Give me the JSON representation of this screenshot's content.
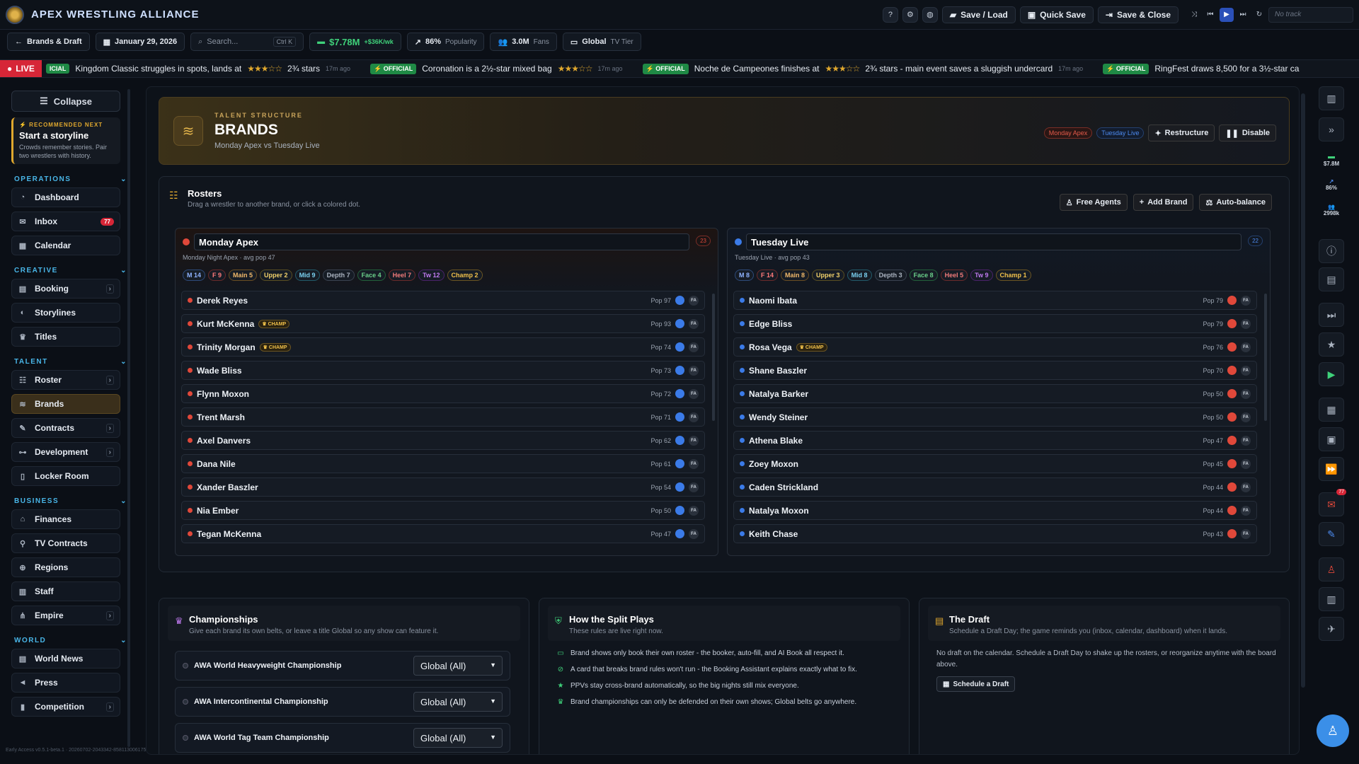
{
  "app": {
    "title": "APEX WRESTLING ALLIANCE"
  },
  "topbar": {
    "save_load": "Save / Load",
    "quick_save": "Quick Save",
    "save_close": "Save & Close",
    "track": "No track"
  },
  "bar2": {
    "back": "Brands & Draft",
    "date": "January 29, 2026",
    "search_placeholder": "Search...",
    "search_kbd": "Ctrl K",
    "money": "$7.78M",
    "money_delta": "+$36K/wk",
    "popularity": "86%",
    "popularity_label": "Popularity",
    "fans": "3.0M",
    "fans_label": "Fans",
    "tier": "Global",
    "tier_label": "TV Tier"
  },
  "ticker": {
    "live": "LIVE",
    "lead_tag": "ICIAL",
    "items": [
      {
        "text": "Kingdom Classic struggles in spots, lands at",
        "stars": "★★★☆☆",
        "rating": "2¾ stars",
        "ago": "17m ago",
        "official": ""
      },
      {
        "official": "⚡ OFFICIAL",
        "text": "Coronation is a 2½-star mixed bag",
        "stars": "★★★☆☆",
        "rating": "",
        "ago": "17m ago"
      },
      {
        "official": "⚡ OFFICIAL",
        "text": "Noche de Campeones finishes at",
        "stars": "★★★☆☆",
        "rating": "2¾ stars - main event saves a sluggish undercard",
        "ago": "17m ago"
      },
      {
        "official": "⚡ OFFICIAL",
        "text": "RingFest draws 8,500 for a 3½-star ca",
        "stars": "",
        "rating": "",
        "ago": ""
      }
    ]
  },
  "sidebar": {
    "collapse": "Collapse",
    "rec_kicker": "⚡ RECOMMENDED NEXT",
    "rec_title": "Start a storyline",
    "rec_desc": "Crowds remember stories. Pair two wrestlers with history.",
    "sections": {
      "operations": "OPERATIONS",
      "creative": "CREATIVE",
      "talent": "TALENT",
      "business": "BUSINESS",
      "world": "WORLD"
    },
    "items": {
      "dashboard": "Dashboard",
      "inbox": "Inbox",
      "inbox_badge": "77",
      "calendar": "Calendar",
      "booking": "Booking",
      "storylines": "Storylines",
      "titles": "Titles",
      "roster": "Roster",
      "brands": "Brands",
      "contracts": "Contracts",
      "development": "Development",
      "locker_room": "Locker Room",
      "finances": "Finances",
      "tv_contracts": "TV Contracts",
      "regions": "Regions",
      "staff": "Staff",
      "empire": "Empire",
      "world_news": "World News",
      "press": "Press",
      "competition": "Competition"
    },
    "version": "Early Access v0.5.1-beta.1 · 20260702-2043342-858113006175"
  },
  "hero": {
    "kicker": "TALENT STRUCTURE",
    "title": "BRANDS",
    "subtitle": "Monday Apex vs Tuesday Live",
    "pill_a": "Monday Apex",
    "pill_b": "Tuesday Live",
    "restructure": "Restructure",
    "disable": "Disable"
  },
  "rosters": {
    "title": "Rosters",
    "desc": "Drag a wrestler to another brand, or click a colored dot.",
    "free_agents": "Free Agents",
    "add_brand": "Add Brand",
    "auto_balance": "Auto-balance",
    "brand_a": {
      "name": "Monday Apex",
      "count": "23",
      "sub": "Monday Night Apex · avg pop 47",
      "tags": [
        "M 14",
        "F 9",
        "Main 5",
        "Upper 2",
        "Mid 9",
        "Depth 7",
        "Face 4",
        "Heel 7",
        "Tw 12",
        "Champ 2"
      ],
      "rows": [
        {
          "name": "Derek Reyes",
          "champ": "",
          "pop": "Pop 97"
        },
        {
          "name": "Kurt McKenna",
          "champ": "♛ CHAMP",
          "pop": "Pop 93"
        },
        {
          "name": "Trinity Morgan",
          "champ": "♛ CHAMP",
          "pop": "Pop 74"
        },
        {
          "name": "Wade Bliss",
          "champ": "",
          "pop": "Pop 73"
        },
        {
          "name": "Flynn Moxon",
          "champ": "",
          "pop": "Pop 72"
        },
        {
          "name": "Trent Marsh",
          "champ": "",
          "pop": "Pop 71"
        },
        {
          "name": "Axel Danvers",
          "champ": "",
          "pop": "Pop 62"
        },
        {
          "name": "Dana Nile",
          "champ": "",
          "pop": "Pop 61"
        },
        {
          "name": "Xander Baszler",
          "champ": "",
          "pop": "Pop 54"
        },
        {
          "name": "Nia Ember",
          "champ": "",
          "pop": "Pop 50"
        },
        {
          "name": "Tegan McKenna",
          "champ": "",
          "pop": "Pop 47"
        }
      ]
    },
    "brand_b": {
      "name": "Tuesday Live",
      "count": "22",
      "sub": "Tuesday Live · avg pop 43",
      "tags": [
        "M 8",
        "F 14",
        "Main 8",
        "Upper 3",
        "Mid 8",
        "Depth 3",
        "Face 8",
        "Heel 5",
        "Tw 9",
        "Champ 1"
      ],
      "rows": [
        {
          "name": "Naomi Ibata",
          "champ": "",
          "pop": "Pop 79"
        },
        {
          "name": "Edge Bliss",
          "champ": "",
          "pop": "Pop 79"
        },
        {
          "name": "Rosa Vega",
          "champ": "♛ CHAMP",
          "pop": "Pop 76"
        },
        {
          "name": "Shane Baszler",
          "champ": "",
          "pop": "Pop 70"
        },
        {
          "name": "Natalya Barker",
          "champ": "",
          "pop": "Pop 50"
        },
        {
          "name": "Wendy Steiner",
          "champ": "",
          "pop": "Pop 50"
        },
        {
          "name": "Athena Blake",
          "champ": "",
          "pop": "Pop 47"
        },
        {
          "name": "Zoey Moxon",
          "champ": "",
          "pop": "Pop 45"
        },
        {
          "name": "Caden Strickland",
          "champ": "",
          "pop": "Pop 44"
        },
        {
          "name": "Natalya Moxon",
          "champ": "",
          "pop": "Pop 44"
        },
        {
          "name": "Keith Chase",
          "champ": "",
          "pop": "Pop 43"
        }
      ]
    },
    "fa_label": "FA"
  },
  "championships": {
    "title": "Championships",
    "desc": "Give each brand its own belts, or leave a title Global so any show can feature it.",
    "items": [
      {
        "name": "AWA World Heavyweight Championship",
        "value": "Global (All)"
      },
      {
        "name": "AWA Intercontinental Championship",
        "value": "Global (All)"
      },
      {
        "name": "AWA World Tag Team Championship",
        "value": "Global (All)"
      }
    ]
  },
  "split": {
    "title": "How the Split Plays",
    "desc": "These rules are live right now.",
    "rules": [
      "Brand shows only book their own roster - the booker, auto-fill, and AI Book all respect it.",
      "A card that breaks brand rules won't run - the Booking Assistant explains exactly what to fix.",
      "PPVs stay cross-brand automatically, so the big nights still mix everyone.",
      "Brand championships can only be defended on their own shows; Global belts go anywhere."
    ]
  },
  "draft": {
    "title": "The Draft",
    "desc": "Schedule a Draft Day; the game reminds you (inbox, calendar, dashboard) when it lands.",
    "text": "No draft on the calendar. Schedule a Draft Day to shake up the rosters, or reorganize anytime with the board above.",
    "button": "Schedule a Draft"
  },
  "rail": {
    "money": "$7.8M",
    "pop": "86%",
    "fans": "2998k",
    "badge": "77"
  },
  "colors": {
    "brand_a": "#e0483a",
    "brand_b": "#3b7be8",
    "accent": "#e0a82e"
  }
}
